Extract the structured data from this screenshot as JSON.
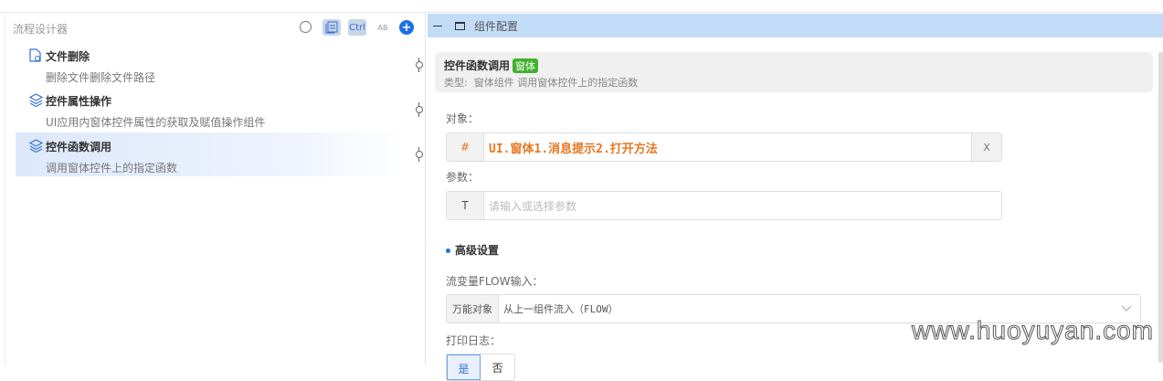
{
  "left_panel": {
    "title": "流程设计器",
    "tools": {
      "ctrl": "Ctrl",
      "ab": "AB",
      "add": "+"
    },
    "items": [
      {
        "title": "文件删除",
        "desc": "删除文件删除文件路径",
        "icon": "file-icon"
      },
      {
        "title": "控件属性操作",
        "desc": "UI应用内窗体控件属性的获取及赋值操作组件",
        "icon": "layers-icon"
      },
      {
        "title": "控件函数调用",
        "desc": "调用窗体控件上的指定函数",
        "icon": "layers-icon",
        "selected": true
      }
    ]
  },
  "right_panel": {
    "header": "组件配置",
    "card": {
      "title": "控件函数调用",
      "badge": "窗体",
      "type_label": "类型:",
      "type_value": "窗体组件 调用窗体控件上的指定函数"
    },
    "object": {
      "label": "对象：",
      "prefix": "#",
      "value": "UI.窗体1.消息提示2.打开方法",
      "clear": "X"
    },
    "params": {
      "label": "参数：",
      "prefix": "T",
      "placeholder": "请输入或选择参数"
    },
    "advanced": "高级设置",
    "flow": {
      "label": "流变量FLOW输入：",
      "prefix": "万能对象",
      "value": "从上一组件流入（FLOW）"
    },
    "log": {
      "label": "打印日志：",
      "options": [
        "是",
        "否"
      ]
    }
  },
  "watermark": "www.huoyuyan.com",
  "colors": {
    "accent": "#1f6fe5",
    "header_bg": "#c2dcf8",
    "badge": "#3fb12d",
    "value": "#e87722"
  }
}
